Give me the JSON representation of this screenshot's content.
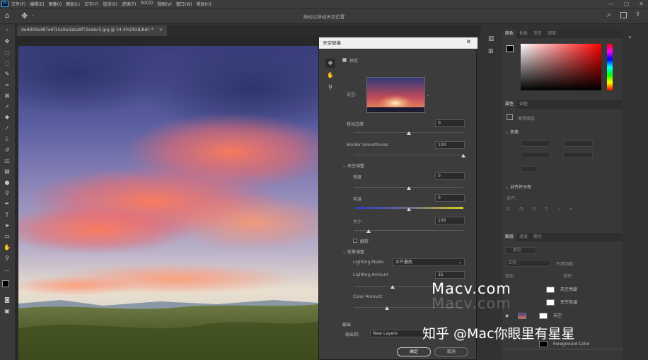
{
  "menubar": {
    "logo": "Ps",
    "items": [
      "文件(F)",
      "编辑(E)",
      "图像(I)",
      "图层(L)",
      "文字(Y)",
      "选择(S)",
      "滤镜(T)",
      "3D(D)",
      "视图(V)",
      "窗口(W)",
      "帮助(H)"
    ],
    "window_buttons": [
      "—",
      "▢",
      "✕"
    ]
  },
  "optionsbar": {
    "center_text": "拖动以移动天空位置"
  },
  "document": {
    "tab_label": "dedd00e487e6f15a9e3aba9f72eebc5.jpg @ 24.4%(RGB/8#) *",
    "tab_close": "×"
  },
  "dialog": {
    "title": "天空替换",
    "close": "✕",
    "preview_label": "预览",
    "preview_checked": true,
    "sky_label": "天空:",
    "shift_edge": {
      "label": "移动边缘",
      "value": "0",
      "level": 0.5
    },
    "border_smoothness": {
      "label": "Border Smoothness",
      "value": "100",
      "level": 1.0
    },
    "sky_adjust": {
      "header": "天空调整",
      "brightness": {
        "label": "亮度",
        "value": "0",
        "level": 0.5
      },
      "temperature": {
        "label": "色温",
        "value": "0",
        "level": 0.5
      },
      "scale": {
        "label": "大小",
        "value": "100",
        "level": 0.13
      },
      "flip_label": "翻转",
      "flip_checked": false
    },
    "foreground": {
      "header": "前景调整",
      "lighting_mode_label": "Lighting Mode:",
      "lighting_mode_value": "正片叠底",
      "lighting_amount": {
        "label": "Lighting Amount",
        "value": "35",
        "level": 0.35
      },
      "color_amount": {
        "label": "Color Amount",
        "value": "",
        "level": 0.3
      }
    },
    "output": {
      "header": "输出",
      "output_to_label": "输出到:",
      "output_to_value": "New Layers"
    },
    "ok_button": "确定",
    "cancel_button": "取消"
  },
  "panels": {
    "color_tabs": [
      "颜色",
      "色板",
      "渐变",
      "图案"
    ],
    "props_tabs": [
      "属性",
      "调整"
    ],
    "props_doc_label": "像素图层",
    "transform_header": "变换",
    "align_header": "对齐并分布",
    "align_sub": "对齐:",
    "layers_tabs": [
      "图层",
      "通道",
      "路径"
    ],
    "layers_search": "类型",
    "blend_mode": "正常",
    "opacity_label": "不透明度:",
    "lock_label": "锁定:",
    "fill_label": "填充:",
    "layers": [
      {
        "name": "天空亮度"
      },
      {
        "name": "天空色温"
      },
      {
        "name": "天空"
      },
      {
        "name": "Foreground Color"
      }
    ]
  },
  "watermark": {
    "line1": "Macv.com",
    "line2": "知乎 @Mac你眼里有星星"
  },
  "colors": {
    "accent": "#31a8ff",
    "dialog_bg": "#3c3c3c",
    "panel_bg": "#383838",
    "app_bg": "#323232"
  }
}
